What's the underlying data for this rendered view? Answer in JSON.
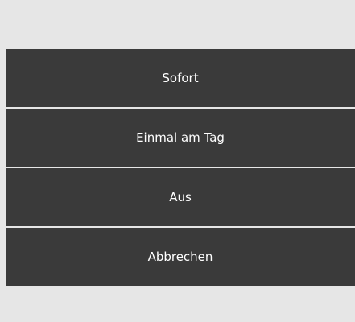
{
  "menu": {
    "items": [
      {
        "label": "Sofort"
      },
      {
        "label": "Einmal am Tag"
      },
      {
        "label": "Aus"
      },
      {
        "label": "Abbrechen"
      }
    ]
  },
  "colors": {
    "background": "#e6e6e6",
    "menu_background": "#3a3a3a",
    "menu_text": "#ffffff",
    "divider": "#e6e6e6"
  }
}
